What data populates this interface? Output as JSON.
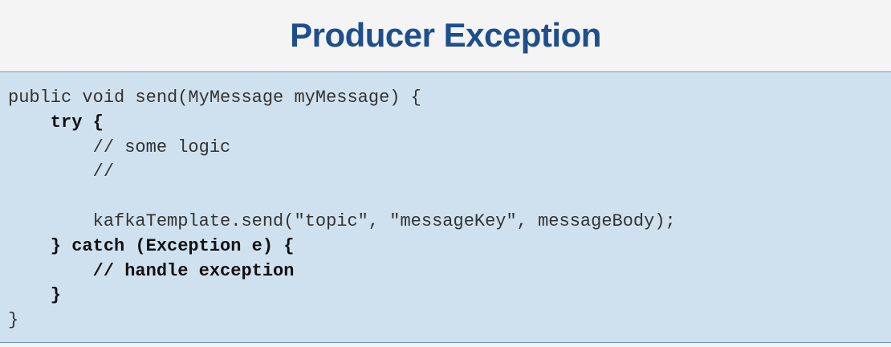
{
  "title": "Producer Exception",
  "code": {
    "lines": [
      {
        "text": "public void send(MyMessage myMessage) {",
        "bold": false
      },
      {
        "text": "    try {",
        "bold": true
      },
      {
        "text": "        // some logic",
        "bold": false
      },
      {
        "text": "        //",
        "bold": false
      },
      {
        "text": "",
        "bold": false
      },
      {
        "text": "        kafkaTemplate.send(\"topic\", \"messageKey\", messageBody);",
        "bold": false
      },
      {
        "text": "    } catch (Exception e) {",
        "bold": true
      },
      {
        "text": "        // handle exception",
        "bold": true
      },
      {
        "text": "    }",
        "bold": true
      },
      {
        "text": "}",
        "bold": false
      }
    ]
  }
}
